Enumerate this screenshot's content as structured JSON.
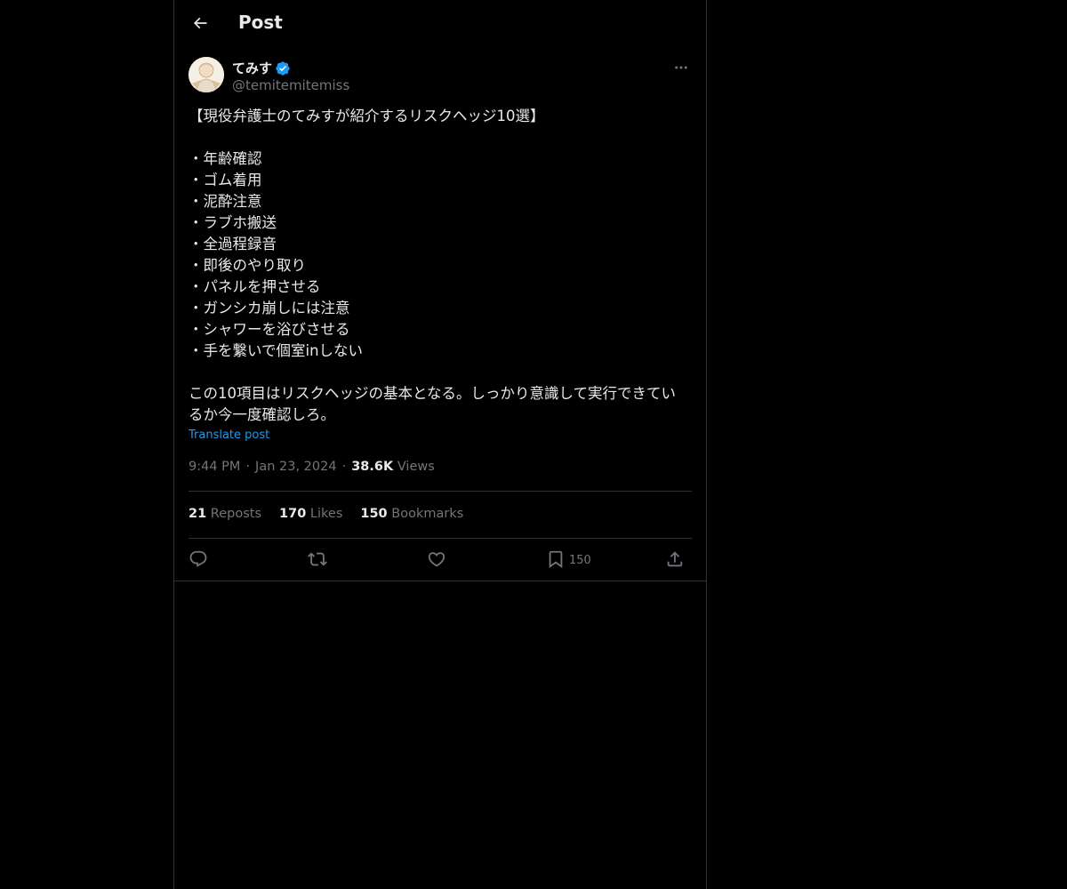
{
  "header": {
    "title": "Post"
  },
  "author": {
    "display_name": "てみす",
    "handle": "@temitemitemiss",
    "verified": true
  },
  "post": {
    "lines": [
      "【現役弁護士のてみすが紹介するリスクヘッジ10選】",
      "",
      "・年齢確認",
      "・ゴム着用",
      "・泥酔注意",
      "・ラブホ搬送",
      "・全過程録音",
      "・即後のやり取り",
      "・パネルを押させる",
      "・ガンシカ崩しには注意",
      "・シャワーを浴びさせる",
      "・手を繋いで個室inしない",
      "",
      "この10項目はリスクヘッジの基本となる。しっかり意識して実行できてい",
      "るか今一度確認しろ。"
    ],
    "translate_label": "Translate post"
  },
  "meta": {
    "time": "9:44 PM",
    "separator": "·",
    "date": "Jan 23, 2024",
    "views_count": "38.6K",
    "views_label": "Views"
  },
  "stats": {
    "reposts_count": "21",
    "reposts_label": "Reposts",
    "likes_count": "170",
    "likes_label": "Likes",
    "bookmarks_count": "150",
    "bookmarks_label": "Bookmarks"
  },
  "actions": {
    "bookmark_count": "150"
  },
  "colors": {
    "background": "#000000",
    "text": "#e7e9ea",
    "secondary": "#71767b",
    "accent": "#1d9bf0",
    "border": "#2f3336"
  },
  "icons": {
    "back": "arrow-left-icon",
    "verified": "verified-badge-icon",
    "more": "more-horizontal-icon",
    "reply": "reply-icon",
    "repost": "repost-icon",
    "like": "heart-icon",
    "bookmark": "bookmark-icon",
    "share": "share-icon"
  }
}
